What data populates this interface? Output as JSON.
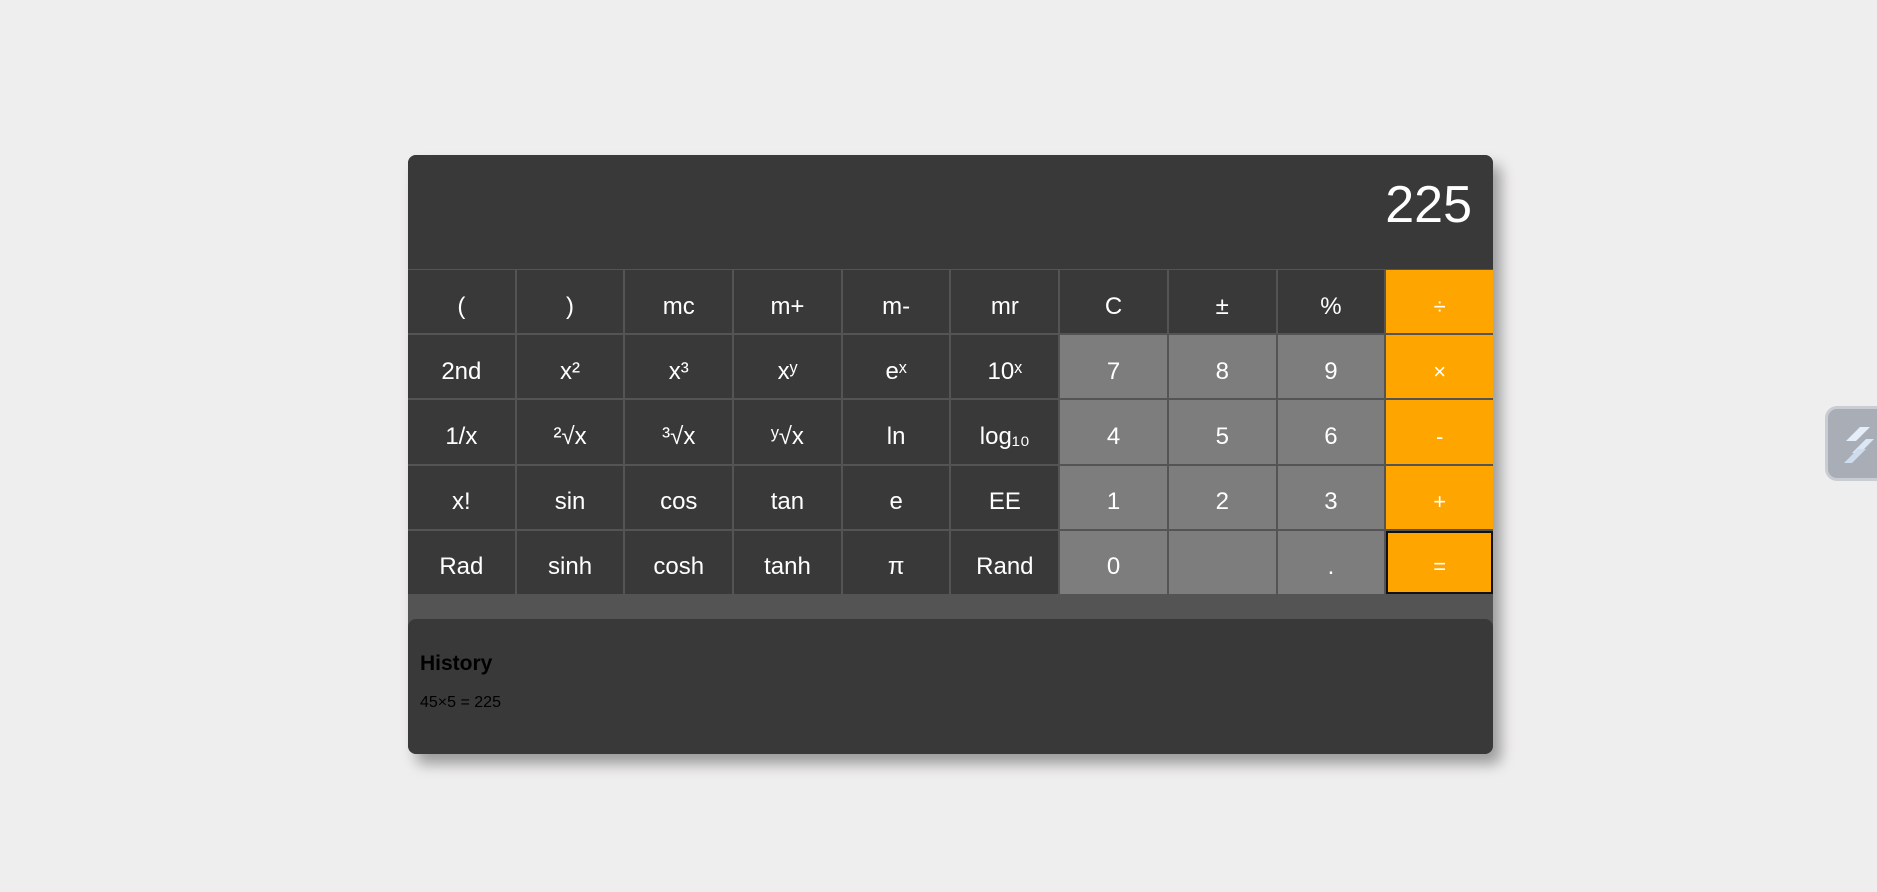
{
  "display": {
    "value": "225"
  },
  "keys": [
    [
      "(",
      ")",
      "mc",
      "m+",
      "m-",
      "mr",
      "C",
      "±",
      "%",
      "÷"
    ],
    [
      "2nd",
      "x²",
      "x³",
      "xʸ",
      "eˣ",
      "10ˣ",
      "7",
      "8",
      "9",
      "×"
    ],
    [
      "1/x",
      "²√x",
      "³√x",
      "ʸ√x",
      "ln",
      "log₁₀",
      "4",
      "5",
      "6",
      "-"
    ],
    [
      "x!",
      "sin",
      "cos",
      "tan",
      "e",
      "EE",
      "1",
      "2",
      "3",
      "+"
    ],
    [
      "Rad",
      "sinh",
      "cosh",
      "tanh",
      "π",
      "Rand",
      "0",
      "",
      ".",
      "="
    ]
  ],
  "history": {
    "title": "History",
    "entries": [
      "45×5 = 225"
    ]
  },
  "colors": {
    "function_key": "#393939",
    "number_key": "#7d7d7d",
    "operator_key": "#ffa500",
    "display_bg": "#393939"
  },
  "icons": {
    "side_widget": "edge-tool-icon"
  }
}
